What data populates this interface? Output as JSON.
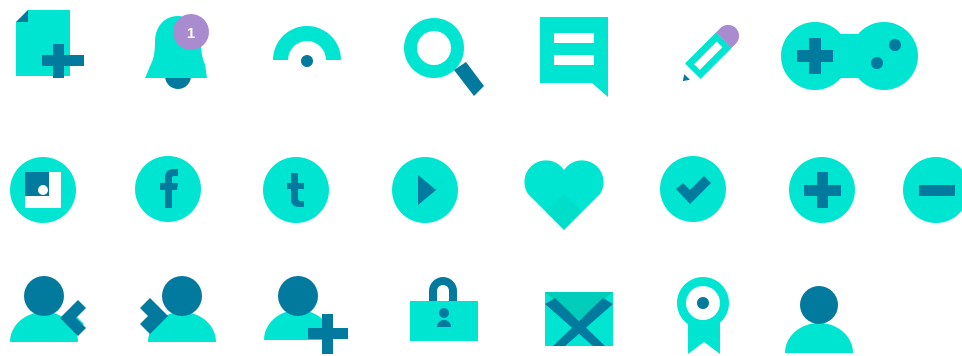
{
  "colors": {
    "primary": "#00E5D1",
    "secondary": "#027A9E",
    "accent": "#A98BD0",
    "background": "#FFFFFF"
  },
  "rows": [
    {
      "icons": [
        {
          "name": "add-document-icon"
        },
        {
          "name": "notification-bell-icon",
          "badge": "1"
        },
        {
          "name": "gauge-icon"
        },
        {
          "name": "search-icon"
        },
        {
          "name": "chat-message-icon"
        },
        {
          "name": "edit-pencil-icon"
        },
        {
          "name": "gamepad-icon"
        }
      ]
    },
    {
      "icons": [
        {
          "name": "instagram-icon"
        },
        {
          "name": "facebook-icon",
          "glyph": "f"
        },
        {
          "name": "tumblr-icon",
          "glyph": "t"
        },
        {
          "name": "play-icon"
        },
        {
          "name": "heart-icon"
        },
        {
          "name": "checkmark-icon"
        },
        {
          "name": "plus-circle-icon"
        },
        {
          "name": "minus-circle-icon"
        }
      ]
    },
    {
      "icons": [
        {
          "name": "user-back-icon"
        },
        {
          "name": "user-forward-icon"
        },
        {
          "name": "add-user-icon"
        },
        {
          "name": "lock-user-icon"
        },
        {
          "name": "mail-icon"
        },
        {
          "name": "award-ribbon-icon"
        },
        {
          "name": "user-icon"
        }
      ]
    }
  ]
}
